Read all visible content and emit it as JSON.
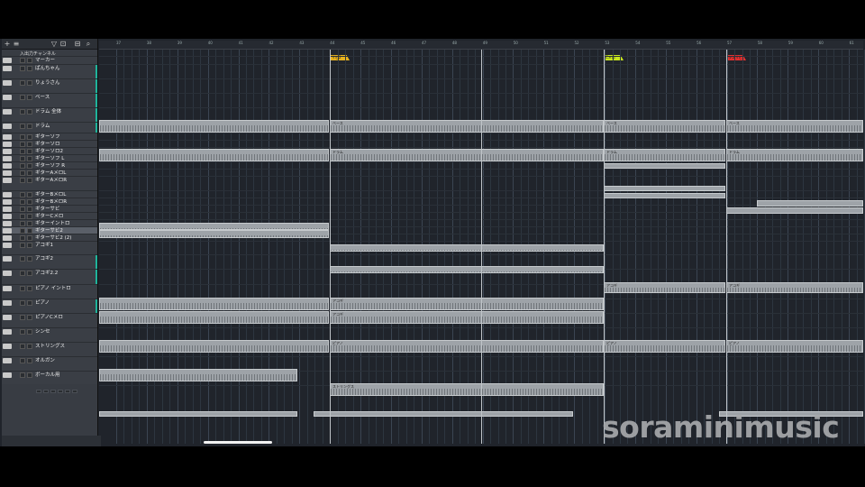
{
  "header": {
    "input_channel_label": "入出力チャンネル",
    "buttons": [
      "+",
      "≡",
      "▽",
      "⊡",
      "⊟",
      "⌕"
    ]
  },
  "ruler": {
    "bars": [
      "37",
      "38",
      "39",
      "40",
      "41",
      "42",
      "43",
      "44",
      "45",
      "46",
      "47",
      "48",
      "49",
      "50",
      "51",
      "52",
      "53",
      "54",
      "55",
      "56",
      "57",
      "58",
      "59",
      "60",
      "61"
    ]
  },
  "markers": [
    {
      "label": "サビ2",
      "color": "#e8b21e"
    },
    {
      "label": "Cメロ",
      "color": "#c8e61e"
    },
    {
      "label": "ラスサビ",
      "color": "#e43030"
    }
  ],
  "tracks": [
    {
      "name": "マーカー",
      "color": "",
      "selected": false
    },
    {
      "name": "ぱんちゃん",
      "color": "#1fb39b",
      "selected": false
    },
    {
      "name": "りょうさん",
      "color": "#1fb39b",
      "selected": false
    },
    {
      "name": "ベース",
      "color": "#1fb39b",
      "selected": false
    },
    {
      "name": "ドラム 全体",
      "color": "#1fb39b",
      "selected": false
    },
    {
      "name": "ドラム",
      "color": "#1fb39b",
      "selected": false
    },
    {
      "name": "ギターソフ",
      "color": "",
      "selected": false
    },
    {
      "name": "ギターソロ",
      "color": "",
      "selected": false
    },
    {
      "name": "ギターソロ2",
      "color": "",
      "selected": false
    },
    {
      "name": "ギターソフ L",
      "color": "",
      "selected": false
    },
    {
      "name": "ギターソフ R",
      "color": "",
      "selected": false
    },
    {
      "name": "ギターAメロL",
      "color": "",
      "selected": false
    },
    {
      "name": "ギターAメロR",
      "color": "",
      "selected": false
    },
    {
      "name": "ギターBメロL",
      "color": "",
      "selected": false
    },
    {
      "name": "ギターBメロR",
      "color": "",
      "selected": false
    },
    {
      "name": "ギターサビ",
      "color": "",
      "selected": false
    },
    {
      "name": "ギターCメロ",
      "color": "",
      "selected": false
    },
    {
      "name": "ギターイントロ",
      "color": "",
      "selected": false
    },
    {
      "name": "ギターサビ2",
      "color": "",
      "selected": true
    },
    {
      "name": "ギターサビ2 (2)",
      "color": "",
      "selected": false
    },
    {
      "name": "アコギ1",
      "color": "",
      "selected": false
    },
    {
      "name": "アコギ2",
      "color": "#1fb39b",
      "selected": false
    },
    {
      "name": "アコギ2.2",
      "color": "#1fb39b",
      "selected": false
    },
    {
      "name": "ピアノ イントロ",
      "color": "",
      "selected": false
    },
    {
      "name": "ピアノ",
      "color": "#1fb39b",
      "selected": false
    },
    {
      "name": "ピアノCメロ",
      "color": "",
      "selected": false
    },
    {
      "name": "シンセ",
      "color": "",
      "selected": false
    },
    {
      "name": "ストリングス",
      "color": "",
      "selected": false
    },
    {
      "name": "オルガン",
      "color": "",
      "selected": false
    },
    {
      "name": "ボーカル用",
      "color": "",
      "selected": false
    }
  ],
  "clip_labels": {
    "bass": "ベース",
    "drums": "ドラム",
    "acoustic": "アコギ",
    "piano": "ピアノ",
    "strings": "ストリングス"
  },
  "watermark": "soraminimusic"
}
